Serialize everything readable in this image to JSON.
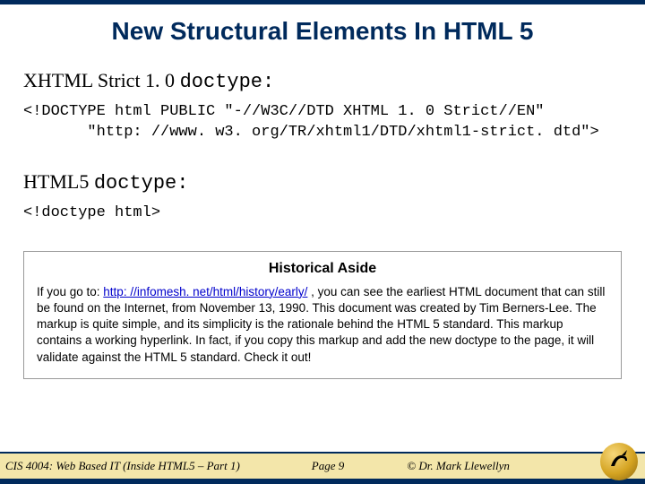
{
  "title": "New Structural Elements In HTML 5",
  "section1": {
    "heading_prefix": "XHTML Strict 1. 0 ",
    "heading_mono": "doctype:",
    "code": "<!DOCTYPE html PUBLIC \"-//W3C//DTD XHTML 1. 0 Strict//EN\"\n       \"http: //www. w3. org/TR/xhtml1/DTD/xhtml1-strict. dtd\">"
  },
  "section2": {
    "heading_prefix": "HTML5 ",
    "heading_mono": "doctype:",
    "code": "<!doctype html>"
  },
  "aside": {
    "title": "Historical Aside",
    "body_before_link": "If you go to: ",
    "link_text": "http: //infomesh. net/html/history/early/",
    "link_href": "http://infomesh.net/html/history/early/",
    "body_after_link": " , you can see the earliest HTML document that can still be found on the Internet, from November 13, 1990. This document was created by Tim Berners-Lee.   The markup is quite simple, and its simplicity is the rationale behind the HTML 5 standard. This markup contains a working hyperlink. In fact, if you copy this markup and add the new doctype to the page, it will validate against the HTML 5 standard.  Check it out!"
  },
  "footer": {
    "left": "CIS 4004: Web Based IT (Inside HTML5 – Part 1)",
    "center": "Page 9",
    "right": "© Dr. Mark Llewellyn"
  }
}
